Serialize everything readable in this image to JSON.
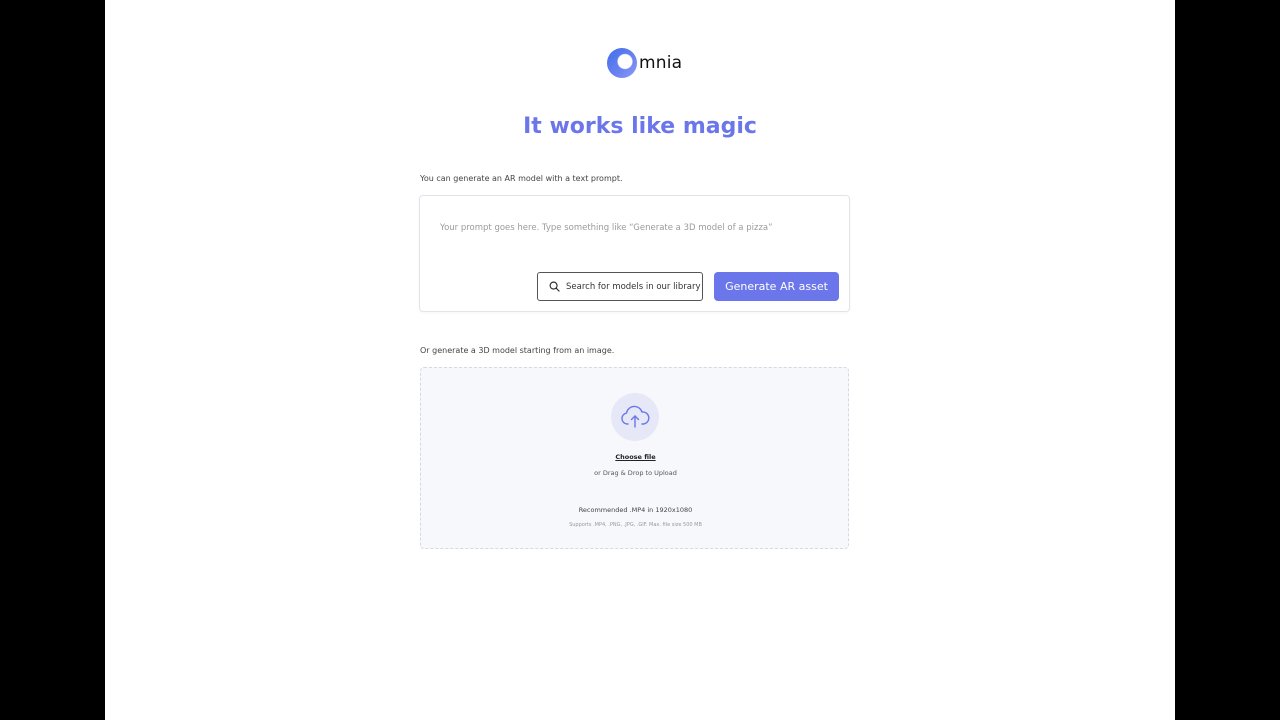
{
  "brand": {
    "logo_text": "mnia",
    "accent_color": "#6b76ea"
  },
  "headline": "It works like magic",
  "text_prompt": {
    "label": "You can generate an AR model with a text prompt.",
    "placeholder": "Your prompt goes here. Type something like “Generate a 3D model of a pizza”",
    "value": "",
    "search_button_label": "Search for models in our library",
    "search_icon": "search-icon",
    "generate_button_label": "Generate AR asset"
  },
  "image_upload": {
    "label": "Or generate a 3D model starting from an image.",
    "upload_icon": "cloud-upload-icon",
    "choose_file_label": "Choose file",
    "drag_text": "or Drag & Drop to Upload",
    "recommended_text": "Recommended .MP4 in 1920x1080",
    "supports_text": "Supports .MP4, .PNG, .JPG, .GIF.  Max. file size 500 MB"
  }
}
